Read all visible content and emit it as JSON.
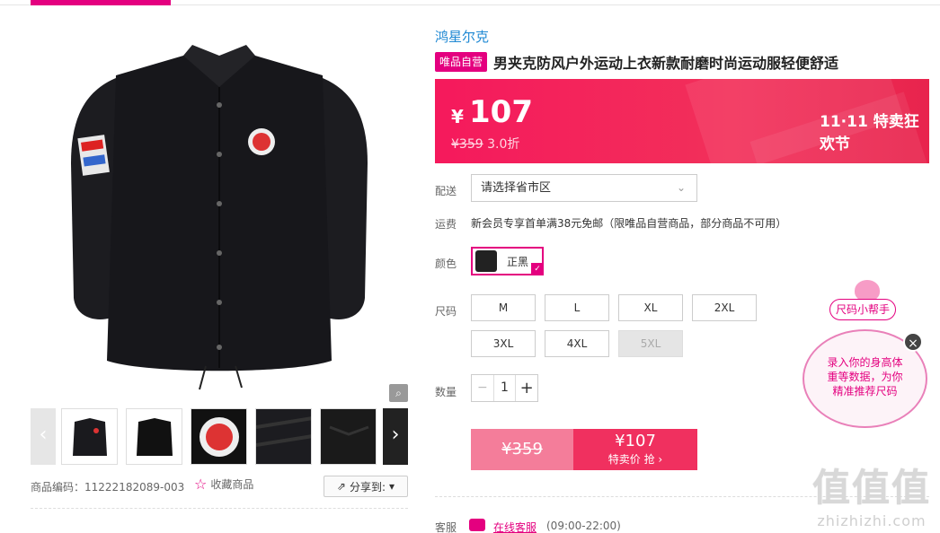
{
  "brand": "鸿星尔克",
  "product": {
    "tag": "唯品自营",
    "title": "男夹克防风户外运动上衣新款耐磨时尚运动服轻便舒适",
    "code_label": "商品编码：",
    "code_value": "11222182089-003",
    "fav_label": "收藏商品",
    "share_label": "分享到:"
  },
  "price": {
    "currency": "¥",
    "value": "107",
    "original": "¥359",
    "discount": "3.0折",
    "festival": "特卖狂欢节",
    "festival_mark": "11·11"
  },
  "delivery": {
    "label": "配送",
    "placeholder": "请选择省市区"
  },
  "shipping": {
    "label": "运费",
    "text": "新会员专享首单满38元免邮（限唯品自营商品，部分商品不可用）"
  },
  "color": {
    "label": "颜色",
    "selected": "正黑"
  },
  "size": {
    "label": "尺码",
    "options": [
      "M",
      "L",
      "XL",
      "2XL",
      "3XL",
      "4XL",
      "5XL"
    ],
    "disabled": [
      "5XL"
    ]
  },
  "quantity": {
    "label": "数量",
    "value": "1",
    "minus": "−",
    "plus": "+"
  },
  "buy": {
    "old_price": "¥359",
    "price": "¥107",
    "action": "特卖价 抢 ›"
  },
  "service": {
    "label": "客服",
    "link": "在线客服",
    "hours": "(09:00-22:00)"
  },
  "helper": {
    "title": "尺码小帮手",
    "text1": "录入你的身高体",
    "text2": "重等数据，为你",
    "text3": "精准推荐尺码"
  },
  "watermark": {
    "big": "值值值",
    "small": "zhizhizhi.com"
  },
  "colors": {
    "accent": "#e4007f",
    "price_bg": "#f5195c",
    "brand": "#1e88d3"
  }
}
